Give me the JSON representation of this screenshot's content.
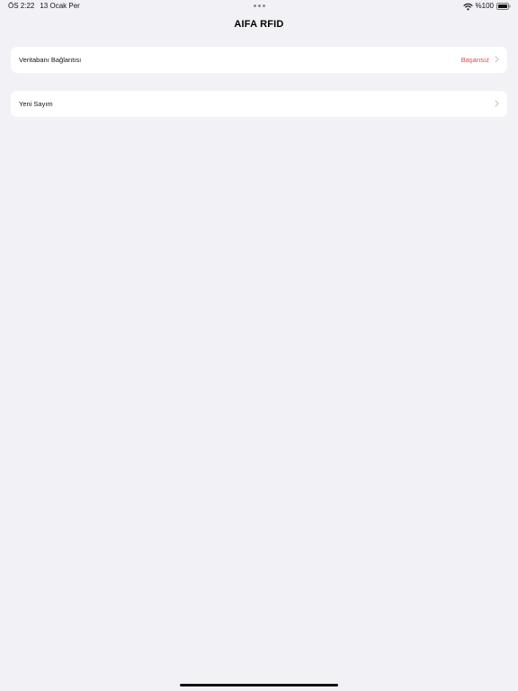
{
  "status_bar": {
    "time": "ÖS 2:22",
    "date": "13 Ocak Per",
    "multitasking_icon": "three-dots-icon",
    "wifi_icon": "wifi-icon",
    "battery": "%100",
    "battery_icon": "battery-icon"
  },
  "navigation": {
    "title": "AIFA RFID"
  },
  "cells": {
    "database": {
      "label": "Veritabanı Bağlantısı",
      "status": "Başarısız",
      "status_color": "#ef4142",
      "icon": "chevron-right-icon"
    },
    "new_count": {
      "label": "Yeni Sayım",
      "icon": "chevron-right-icon"
    }
  },
  "colors": {
    "background": "#f2f1f6",
    "cell_background": "#ffffff",
    "chevron": "#c4c4c7",
    "text": "#141414"
  },
  "system": {
    "home_indicator": "home-indicator"
  }
}
